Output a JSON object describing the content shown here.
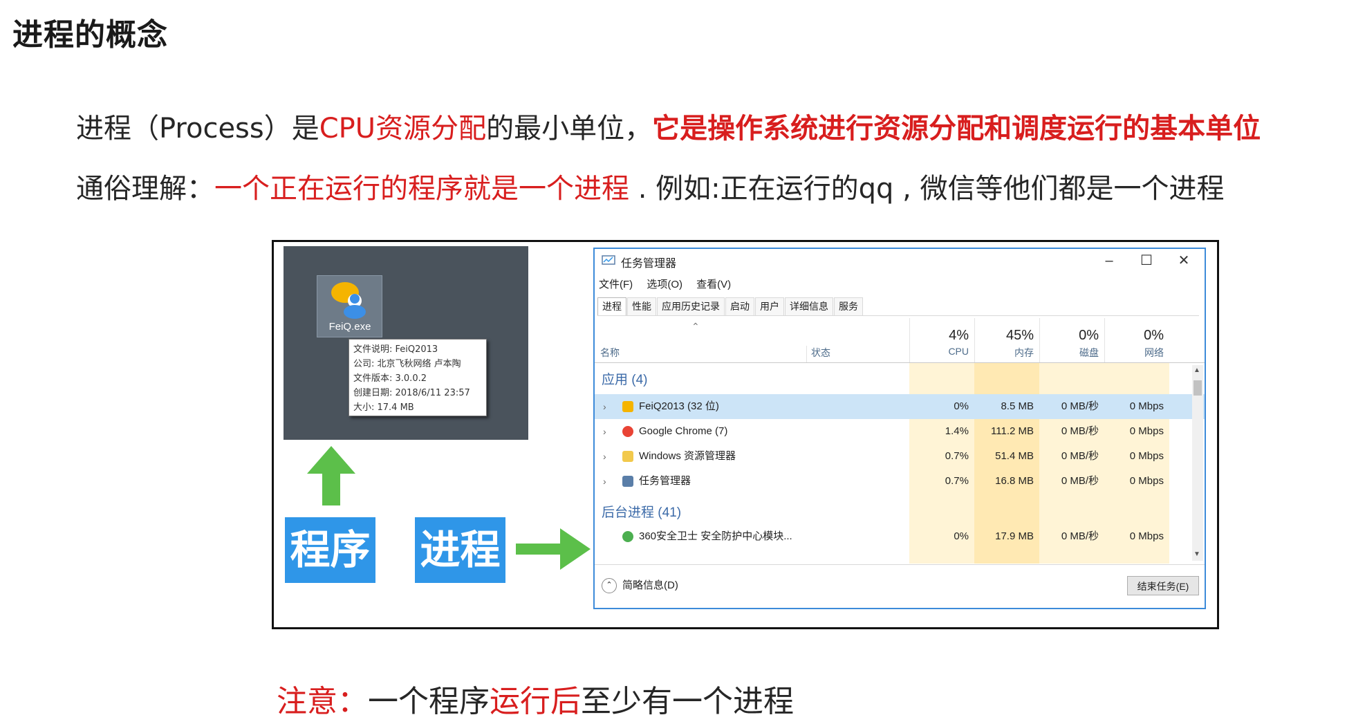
{
  "title": "进程的概念",
  "line1": {
    "part1": "进程（Process）是",
    "part2_red": "CPU资源分配",
    "part3": "的最小单位，",
    "part4_red_bold": "它是操作系统进行资源分配和调度运行的基本单位"
  },
  "line2": {
    "part1": "通俗理解：",
    "part2_red": "一个正在运行的程序就是一个进程",
    "part3": " . 例如:正在运行的qq , 微信等他们都是一个进程"
  },
  "figure": {
    "desktop": {
      "icon_label": "FeiQ.exe",
      "tooltip": [
        "文件说明: FeiQ2013",
        "公司: 北京飞秋网络 卢本陶",
        "文件版本: 3.0.0.2",
        "创建日期: 2018/6/11 23:57",
        "大小: 17.4 MB"
      ]
    },
    "program_label": "程序",
    "process_label": "进程",
    "task_manager": {
      "title": "任务管理器",
      "controls": [
        "–",
        "☐",
        "✕"
      ],
      "menu": [
        "文件(F)",
        "选项(O)",
        "查看(V)"
      ],
      "tabs": [
        "进程",
        "性能",
        "应用历史记录",
        "启动",
        "用户",
        "详细信息",
        "服务"
      ],
      "columns": {
        "name": "名称",
        "status": "状态",
        "cpu": {
          "pct": "4%",
          "label": "CPU"
        },
        "mem": {
          "pct": "45%",
          "label": "内存"
        },
        "disk": {
          "pct": "0%",
          "label": "磁盘"
        },
        "net": {
          "pct": "0%",
          "label": "网络"
        }
      },
      "apps_header": "应用 (4)",
      "apps": [
        {
          "name": "FeiQ2013 (32 位)",
          "cpu": "0%",
          "mem": "8.5 MB",
          "disk": "0 MB/秒",
          "net": "0 Mbps"
        },
        {
          "name": "Google Chrome (7)",
          "cpu": "1.4%",
          "mem": "111.2 MB",
          "disk": "0 MB/秒",
          "net": "0 Mbps"
        },
        {
          "name": "Windows 资源管理器",
          "cpu": "0.7%",
          "mem": "51.4 MB",
          "disk": "0 MB/秒",
          "net": "0 Mbps"
        },
        {
          "name": "任务管理器",
          "cpu": "0.7%",
          "mem": "16.8 MB",
          "disk": "0 MB/秒",
          "net": "0 Mbps"
        }
      ],
      "bg_header": "后台进程 (41)",
      "bg": [
        {
          "name": "360安全卫士 安全防护中心模块...",
          "cpu": "0%",
          "mem": "17.9 MB",
          "disk": "0 MB/秒",
          "net": "0 Mbps"
        }
      ],
      "footer": {
        "brief": "简略信息(D)",
        "end_task": "结束任务(E)"
      }
    }
  },
  "note": {
    "label_red": "注意：",
    "part2": "一个程序",
    "part3_red": "运行后",
    "part4": "至少有一个进程"
  }
}
